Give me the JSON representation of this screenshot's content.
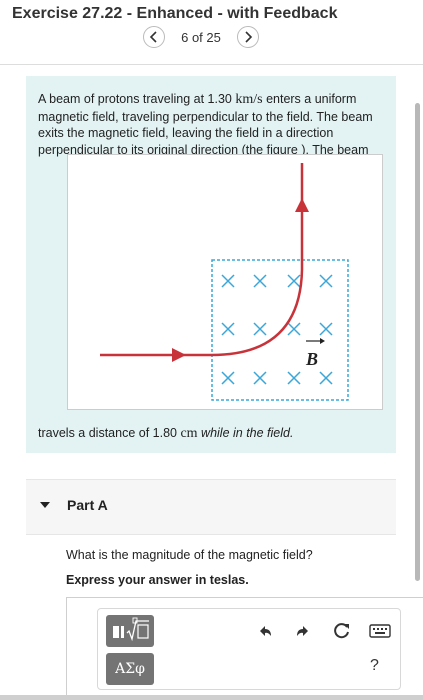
{
  "header": {
    "title": "Exercise 27.22 - Enhanced - with Feedback",
    "pagination": "6 of 25"
  },
  "problem": {
    "text_before": "A beam of protons traveling at 1.30 ",
    "speed_unit": "km/s",
    "text_after_unit": " enters a uniform magnetic field, traveling perpendicular to the field. The beam exits the magnetic field, leaving the field in a direction perpendicular to its original direction (the figure ). The beam",
    "continuation_before": "travels a distance of 1.80 ",
    "distance_unit": "cm",
    "continuation_italic": " while in the field.",
    "figure": {
      "field_label": "B",
      "field_symbol": "×",
      "colors": {
        "beam": "#c8333a",
        "field_region": "#3aa7d8",
        "x_marks": "#3aa7d8"
      }
    }
  },
  "part": {
    "label": "Part A",
    "question": "What is the magnitude of the magnetic field?",
    "instruction": "Express your answer in teslas."
  },
  "toolbar": {
    "template_button_icon": "fraction-radical-template-icon",
    "symbols_button_label": "ΑΣφ",
    "help_label": "?",
    "icons": [
      "undo-icon",
      "redo-icon",
      "reset-icon",
      "keyboard-icon"
    ]
  }
}
